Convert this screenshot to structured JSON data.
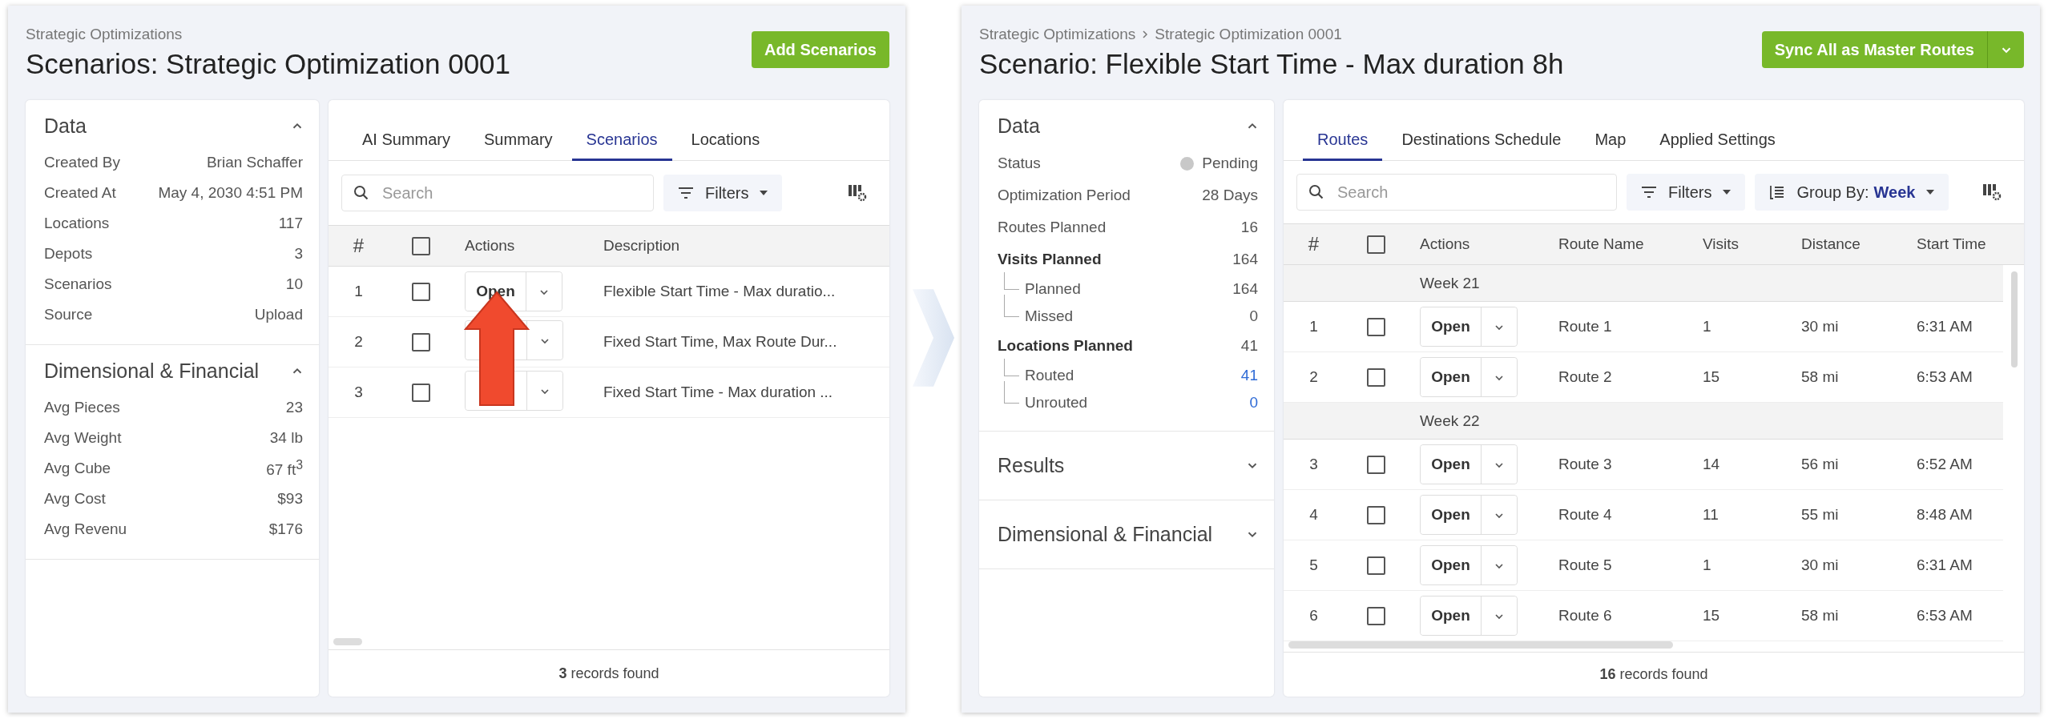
{
  "windows": [
    {
      "breadcrumb": [
        "Strategic Optimizations"
      ],
      "title": "Scenarios: Strategic Optimization 0001",
      "primary_button": {
        "label": "Add Scenarios",
        "has_menu": false
      },
      "side_sections": [
        {
          "title": "Data",
          "expanded": true,
          "rows": [
            {
              "label": "Created By",
              "value": "Brian Schaffer"
            },
            {
              "label": "Created At",
              "value": "May 4, 2030 4:51 PM"
            },
            {
              "label": "Locations",
              "value": "117"
            },
            {
              "label": "Depots",
              "value": "3"
            },
            {
              "label": "Scenarios",
              "value": "10"
            },
            {
              "label": "Source",
              "value": "Upload"
            }
          ]
        },
        {
          "title": "Dimensional & Financial",
          "expanded": true,
          "rows": [
            {
              "label": "Avg Pieces",
              "value": "23"
            },
            {
              "label": "Avg Weight",
              "value": "34 lb"
            },
            {
              "label": "Avg Cube",
              "value": "67 ft$^{3}$"
            },
            {
              "label": "Avg Cost",
              "value": "$93"
            },
            {
              "label": "Avg Revenu",
              "value": "$176"
            }
          ]
        }
      ],
      "tabs": [
        {
          "label": "AI Summary",
          "selected": false
        },
        {
          "label": "Summary",
          "selected": false
        },
        {
          "label": "Scenarios",
          "selected": true
        },
        {
          "label": "Locations",
          "selected": false
        }
      ],
      "search": {
        "placeholder": "Search"
      },
      "filters": "Filters",
      "columns": [
        {
          "kind": "number",
          "label": "#"
        },
        {
          "kind": "checkbox",
          "checked": false
        },
        {
          "kind": "actions",
          "label": "Actions"
        },
        {
          "kind": "text",
          "label": "Description"
        }
      ],
      "rows": [
        {
          "kind": "row",
          "number": "1",
          "checked": false,
          "action": "Open",
          "cells": [
            "Flexible Start Time - Max duratio..."
          ]
        },
        {
          "kind": "row",
          "number": "2",
          "checked": false,
          "cells": [
            "Fixed Start Time, Max Route Dur..."
          ]
        },
        {
          "kind": "row",
          "number": "3",
          "checked": false,
          "cells": [
            "Fixed Start Time - Max duration ..."
          ]
        }
      ],
      "footer": "**3** records found"
    },
    {
      "breadcrumb": [
        "Strategic Optimizations",
        "Strategic Optimization 0001"
      ],
      "title": "Scenario: Flexible Start Time - Max duration 8h",
      "primary_button": {
        "label": "Sync All as Master Routes",
        "has_menu": true
      },
      "side_sections": [
        {
          "title": "Data",
          "expanded": true,
          "rows": [
            {
              "label": "Status",
              "value": "Pending",
              "color": "#c8c8c8"
            },
            {
              "label": "Optimization Period",
              "value": "28 Days"
            },
            {
              "label": "Routes Planned",
              "value": "16"
            },
            {
              "label": "Visits Planned",
              "value": "164",
              "children": [
                {
                  "label": "Planned",
                  "value": "164",
                  "link": false
                },
                {
                  "label": "Missed",
                  "value": "0",
                  "link": false
                }
              ]
            },
            {
              "label": "Locations Planned",
              "value": "41",
              "children": [
                {
                  "label": "Routed",
                  "value": "41",
                  "link": true
                },
                {
                  "label": "Unrouted",
                  "value": "0",
                  "link": true
                }
              ]
            }
          ]
        },
        {
          "title": "Results",
          "expanded": false
        },
        {
          "title": "Dimensional & Financial",
          "expanded": false
        }
      ],
      "tabs": [
        {
          "label": "Routes",
          "selected": true
        },
        {
          "label": "Destinations Schedule",
          "selected": false
        },
        {
          "label": "Map",
          "selected": false
        },
        {
          "label": "Applied Settings",
          "selected": false
        }
      ],
      "search": {
        "placeholder": "Search"
      },
      "filters": "Filters",
      "group_by": {
        "label": "Group By:",
        "value": "Week"
      },
      "columns": [
        {
          "kind": "number",
          "label": "#"
        },
        {
          "kind": "checkbox",
          "checked": false
        },
        {
          "kind": "actions",
          "label": "Actions"
        },
        {
          "kind": "text",
          "label": "Route Name"
        },
        {
          "kind": "text",
          "label": "Visits"
        },
        {
          "kind": "text",
          "label": "Distance"
        },
        {
          "kind": "text",
          "label": "Start Time"
        }
      ],
      "rows": [
        {
          "kind": "group",
          "label": "Week 21"
        },
        {
          "kind": "row",
          "number": "1",
          "checked": false,
          "action": "Open",
          "cells": [
            "Route 1",
            "1",
            "30 mi",
            "6:31 AM"
          ]
        },
        {
          "kind": "row",
          "number": "2",
          "checked": false,
          "action": "Open",
          "cells": [
            "Route 2",
            "15",
            "58 mi",
            "6:53 AM"
          ]
        },
        {
          "kind": "group",
          "label": "Week 22"
        },
        {
          "kind": "row",
          "number": "3",
          "checked": false,
          "action": "Open",
          "cells": [
            "Route 3",
            "14",
            "56 mi",
            "6:52 AM"
          ]
        },
        {
          "kind": "row",
          "number": "4",
          "checked": false,
          "action": "Open",
          "cells": [
            "Route 4",
            "11",
            "55 mi",
            "8:48 AM"
          ]
        },
        {
          "kind": "row",
          "number": "5",
          "checked": false,
          "action": "Open",
          "cells": [
            "Route 5",
            "1",
            "30 mi",
            "6:31 AM"
          ]
        },
        {
          "kind": "row",
          "number": "6",
          "checked": false,
          "action": "Open",
          "cells": [
            "Route 6",
            "15",
            "58 mi",
            "6:53 AM"
          ]
        }
      ],
      "footer": "**16** records found"
    }
  ]
}
